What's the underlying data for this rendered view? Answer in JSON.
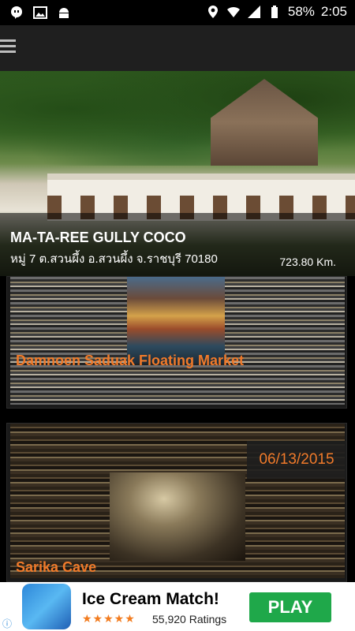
{
  "status_bar": {
    "icons_left": [
      "hangouts-icon",
      "image-icon",
      "android-icon"
    ],
    "icons_right": [
      "location-icon",
      "wifi-icon",
      "signal-icon",
      "battery-icon"
    ],
    "battery": "58%",
    "time": "2:05"
  },
  "app_bar": {
    "menu_icon": "hamburger-menu-icon"
  },
  "featured": {
    "title": "MA-TA-REE GULLY COCO",
    "address": "หมู่ 7 ต.สวนผึ้ง อ.สวนผึ้ง จ.ราชบุรี 70180",
    "distance": "723.80 Km."
  },
  "cards": [
    {
      "title": "Damnoen Saduak Floating Market"
    },
    {
      "title": "Sarika Cave",
      "date": "06/13/2015"
    }
  ],
  "ad": {
    "title": "Ice Cream Match!",
    "stars": "★★★★★",
    "ratings": "55,920 Ratings",
    "button": "PLAY",
    "info_icon": "adchoices-icon"
  }
}
